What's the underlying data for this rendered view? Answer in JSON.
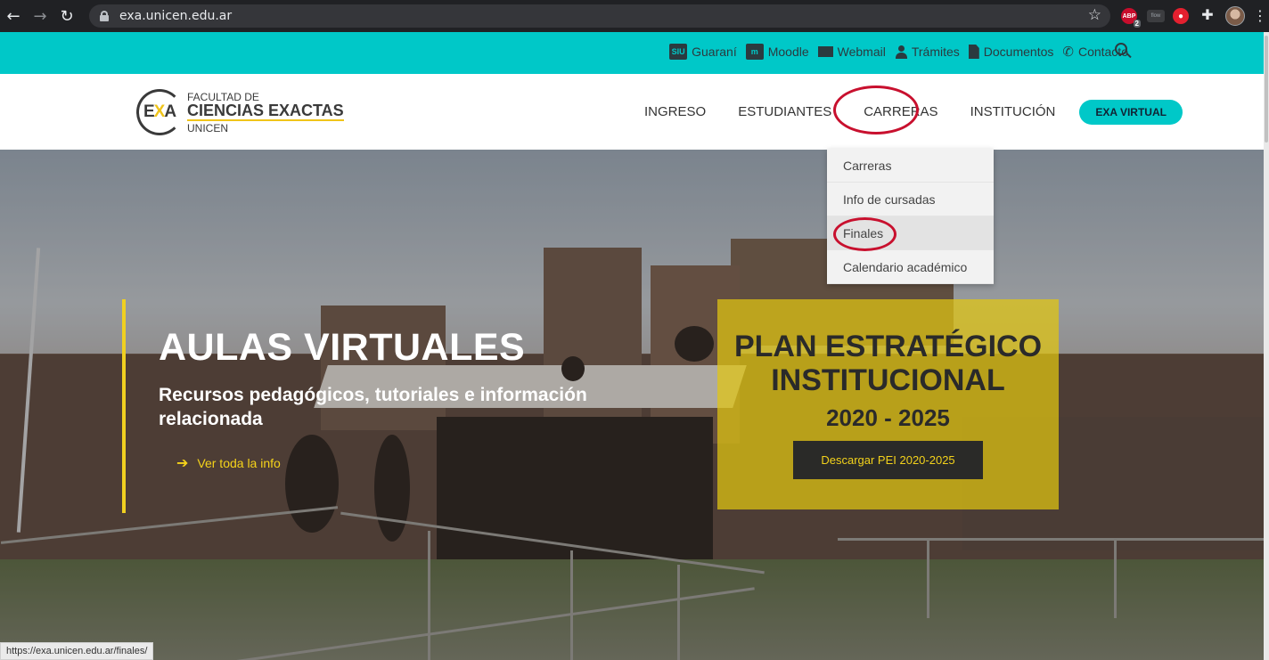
{
  "browser": {
    "url": "exa.unicen.edu.ar",
    "abp_badge": "2",
    "abp_label": "ABP",
    "flow_label": "flow"
  },
  "topbar": {
    "links": [
      {
        "label": "Guaraní",
        "icon": "siu-icon",
        "icon_text": "SIU"
      },
      {
        "label": "Moodle",
        "icon": "moodle-icon",
        "icon_text": "m"
      },
      {
        "label": "Webmail",
        "icon": "envelope-icon"
      },
      {
        "label": "Trámites",
        "icon": "user-icon"
      },
      {
        "label": "Documentos",
        "icon": "document-icon"
      },
      {
        "label": "Contacto",
        "icon": "phone-icon"
      }
    ]
  },
  "logo": {
    "mark": "EXA",
    "line1": "FACULTAD DE",
    "line2": "CIENCIAS EXACTAS",
    "line3": "UNICEN"
  },
  "nav": {
    "items": [
      "INGRESO",
      "ESTUDIANTES",
      "CARRERAS",
      "INSTITUCIÓN"
    ],
    "cta": "EXA VIRTUAL"
  },
  "dropdown": {
    "items": [
      "Carreras",
      "Info de cursadas",
      "Finales",
      "Calendario académico"
    ]
  },
  "hero": {
    "title": "AULAS VIRTUALES",
    "subtitle": "Recursos pedagógicos, tutoriales e información relacionada",
    "link": "Ver toda la info"
  },
  "plan": {
    "title_line1": "PLAN ESTRATÉGICO",
    "title_line2": "INSTITUCIONAL",
    "years": "2020 - 2025",
    "button": "Descargar PEI 2020-2025"
  },
  "status_bar_url": "https://exa.unicen.edu.ar/finales/",
  "colors": {
    "teal": "#00c8c8",
    "yellow": "#f0d020",
    "annotation_red": "#c8102e"
  }
}
